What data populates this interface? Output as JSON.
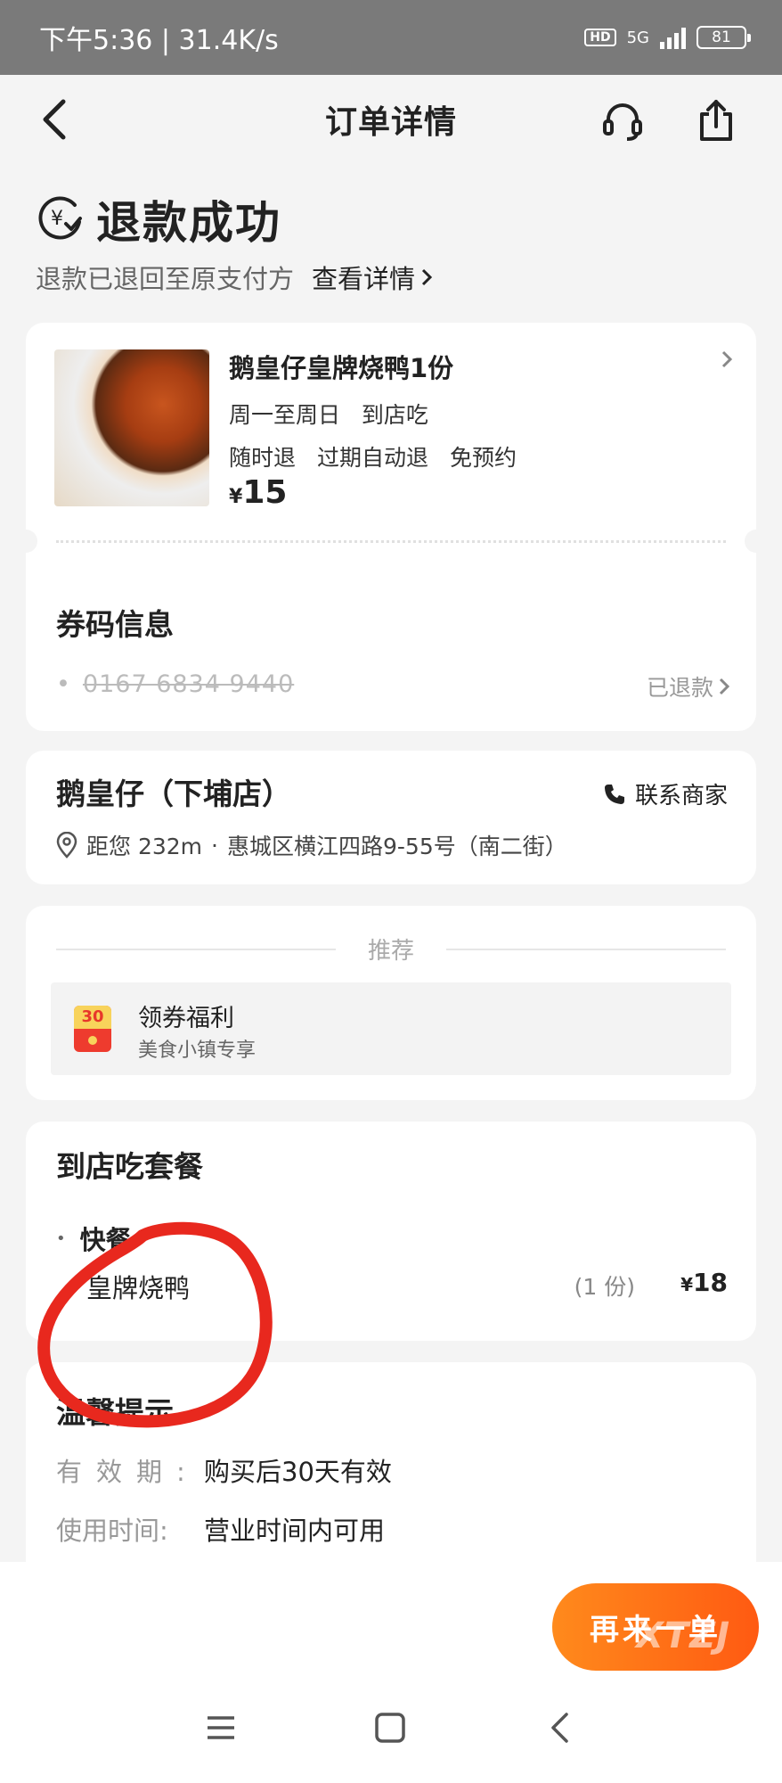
{
  "status_bar": {
    "time": "下午5:36 | 31.4K/s",
    "hd": "HD",
    "network": "5G",
    "battery": "81"
  },
  "nav": {
    "title": "订单详情",
    "icons": [
      "back-icon",
      "customer-service-icon",
      "share-icon"
    ]
  },
  "refund": {
    "status": "退款成功",
    "desc": "退款已退回至原支付方",
    "detail_link": "查看详情",
    "icon": "yen-refund-icon"
  },
  "product": {
    "name": "鹅皇仔皇牌烧鸭1份",
    "days": "周一至周日",
    "mode": "到店吃",
    "tags": [
      "随时退",
      "过期自动退",
      "免预约"
    ],
    "currency": "¥",
    "price": "15"
  },
  "voucher": {
    "title": "券码信息",
    "code": "0167 6834 9440",
    "status": "已退款"
  },
  "store": {
    "name": "鹅皇仔（下埔店）",
    "contact": "联系商家",
    "distance": "距您 232m",
    "address": "惠城区横江四路9-55号（南二街）"
  },
  "recommend": {
    "label": "推荐",
    "coupon_badge": "30",
    "coupon_title": "领券福利",
    "coupon_sub": "美食小镇专享"
  },
  "package": {
    "title": "到店吃套餐",
    "category": "快餐",
    "item_name": "皇牌烧鸭",
    "item_qty": "(1 份)",
    "currency": "¥",
    "item_price": "18"
  },
  "tips": {
    "title": "温馨提示",
    "rows": [
      {
        "label": "有效期:",
        "value": "购买后30天有效"
      },
      {
        "label": "使用时间:",
        "value": "营业时间内可用"
      }
    ]
  },
  "footer": {
    "reorder": "再来一单",
    "watermark": "XTZJ"
  },
  "colors": {
    "accent": "#ff6a13",
    "annotation": "#e8281e",
    "coupon_red": "#ee3b2e"
  }
}
